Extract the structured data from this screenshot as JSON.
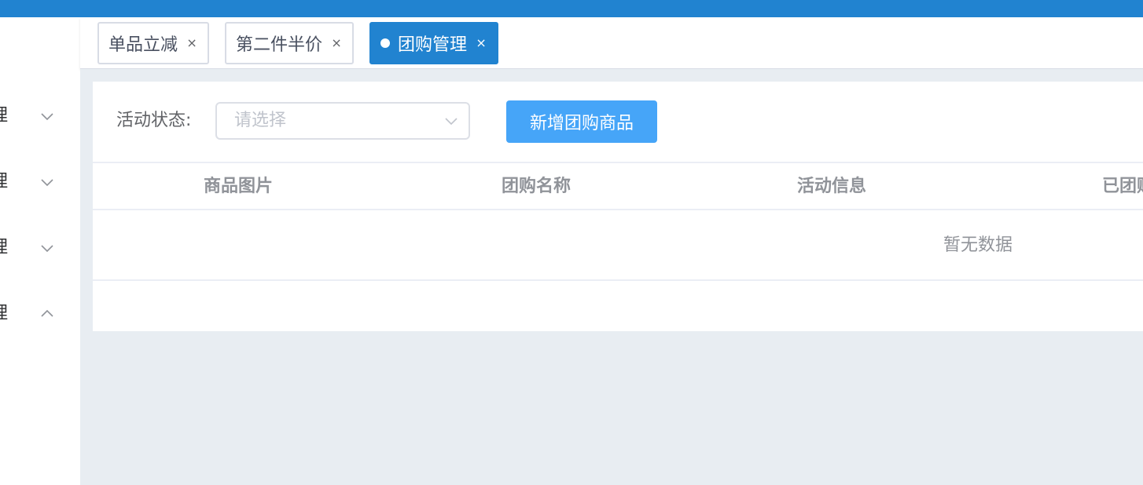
{
  "sidebar": {
    "items": [
      {
        "label": "理",
        "expanded": false,
        "chevron": "chevron-down-icon"
      },
      {
        "label": "理",
        "expanded": false,
        "chevron": "chevron-down-icon"
      },
      {
        "label": "理",
        "expanded": false,
        "chevron": "chevron-down-icon"
      },
      {
        "label": "理",
        "expanded": true,
        "chevron": "chevron-up-icon"
      }
    ]
  },
  "tags": [
    {
      "label": "单品立减",
      "close": "×",
      "active": false
    },
    {
      "label": "第二件半价",
      "close": "×",
      "active": false
    },
    {
      "label": "团购管理",
      "close": "×",
      "active": true
    }
  ],
  "filter": {
    "label": "活动状态:",
    "select_placeholder": "请选择"
  },
  "add_button_label": "新增团购商品",
  "table": {
    "columns": [
      "商品图片",
      "团购名称",
      "活动信息",
      "已团购"
    ],
    "empty_text": "暂无数据"
  },
  "colors": {
    "topbar": "#2183d0",
    "active_tag": "#2183d0",
    "primary_button": "#46a5f8",
    "main_bg": "#e8edf2"
  }
}
